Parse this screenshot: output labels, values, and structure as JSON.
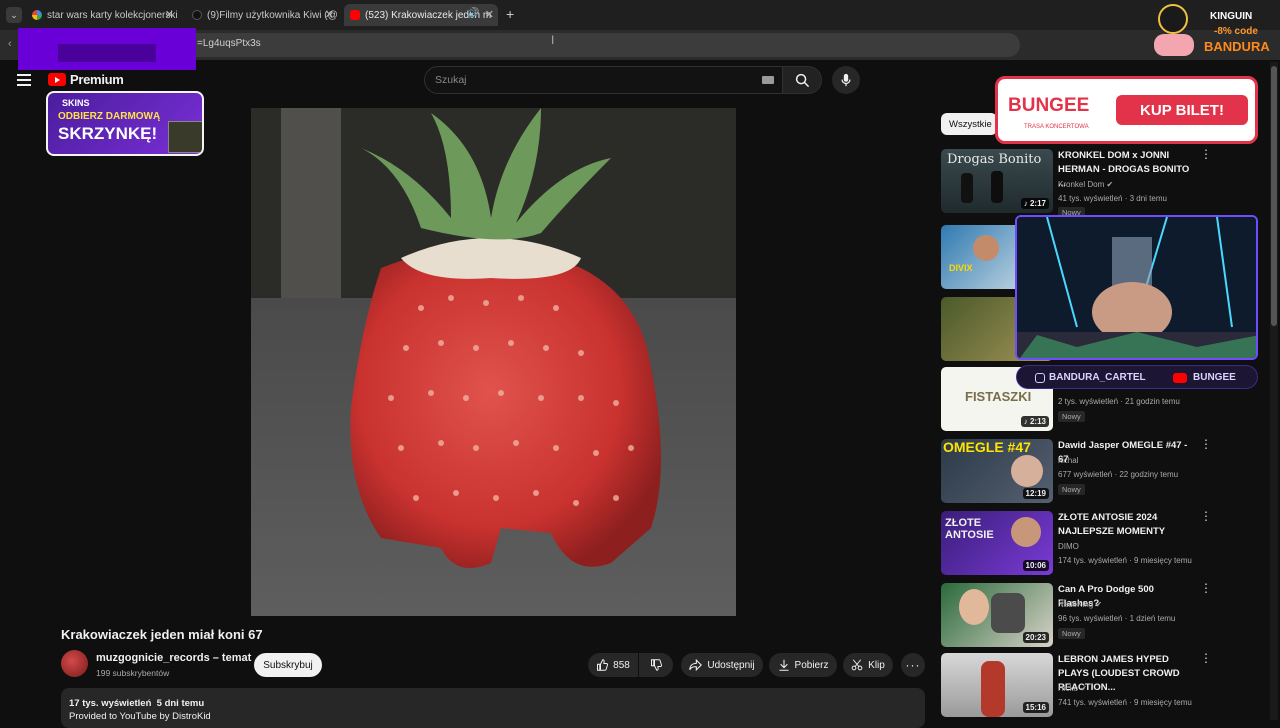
{
  "browser": {
    "tabs": [
      {
        "label": "star wars karty kolekcjonerskie",
        "favicon": "google-icon"
      },
      {
        "label": "(9)Filmy użytkownika Kiwi (@ki",
        "favicon": "tiktok-icon"
      },
      {
        "label": "(523) Krakowiaczek jeden m",
        "favicon": "youtube-icon",
        "active": true
      }
    ],
    "url_fragment": "=Lg4uqsPtx3s"
  },
  "header": {
    "logo_label": "Premium",
    "search_placeholder": "Szukaj"
  },
  "video": {
    "title": "Krakowiaczek jeden miał koni 67",
    "channel": "muzgognicie_records – temat",
    "subscribers": "199 subskrybentów",
    "subscribe_label": "Subskrybuj",
    "likes": "858",
    "share_label": "Udostępnij",
    "download_label": "Pobierz",
    "clip_label": "Klip",
    "description_stats": "17 tys. wyświetleń  5 dni temu",
    "description_text": "Provided to YouTube by DistroKid"
  },
  "sidebar": {
    "chip_label": "Wszystkie",
    "items": [
      {
        "title": "KRONKEL DOM x JONNI HERMAN - DROGAS BONITO ...",
        "channel": "Kronkel Dom",
        "meta": "41 tys. wyświetleń · 3 dni temu",
        "badge": "Nowy",
        "duration": "2:17",
        "thumb_text": "Drogas Bonito"
      },
      {
        "title": "",
        "channel": "",
        "meta": "",
        "badge": "",
        "duration": "",
        "thumb_text": "DIVIX"
      },
      {
        "title": "",
        "channel": "",
        "meta": "",
        "badge": "",
        "duration": "",
        "thumb_text": ""
      },
      {
        "title": "",
        "channel": "",
        "meta": "2 tys. wyświetleń · 21 godzin temu",
        "badge": "Nowy",
        "duration": "2:13",
        "thumb_text": "FISTASZKI"
      },
      {
        "title": "Dawid Jasper OMEGLE #47 - 67",
        "channel": "kichal",
        "meta": "677 wyświetleń · 22 godziny temu",
        "badge": "Nowy",
        "duration": "12:19",
        "thumb_text": "OMEGLE #47"
      },
      {
        "title": "ZŁOTE ANTOSIE 2024 NAJLEPSZE MOMENTY",
        "channel": "DIMO",
        "meta": "174 tys. wyświetleń · 9 miesięcy temu",
        "badge": "",
        "duration": "10:06",
        "thumb_text": "ZŁOTE ANTOSIE"
      },
      {
        "title": "Can A Pro Dodge 500 Flashes?",
        "channel": "NadeKing",
        "meta": "96 tys. wyświetleń · 1 dzień temu",
        "badge": "Nowy",
        "duration": "20:23",
        "thumb_text": ""
      },
      {
        "title": "LEBRON JAMES HYPED PLAYS (LOUDEST CROWD REACTION...",
        "channel": "Hicko",
        "meta": "741 tys. wyświetleń · 9 miesięcy temu",
        "badge": "",
        "duration": "15:16",
        "thumb_text": ""
      }
    ]
  },
  "overlays": {
    "skins_ad": {
      "brand": "SKINS",
      "line1": "ODBIERZ DARMOWĄ",
      "line2": "SKRZYNKĘ!"
    },
    "bungee_ad": {
      "brand": "BUNGEE",
      "sub": "TRASA KONCERTOWA",
      "cta": "KUP BILET!"
    },
    "social": {
      "instagram": "BANDURA_CARTEL",
      "youtube": "BUNGEE"
    },
    "kinguin": {
      "brand": "KINGUIN",
      "code": "-8% code",
      "name": "BANDURA"
    }
  },
  "colors": {
    "accent": "#ff0000",
    "bg": "#0f0f0f",
    "overlay_purple": "#6a00d8"
  }
}
